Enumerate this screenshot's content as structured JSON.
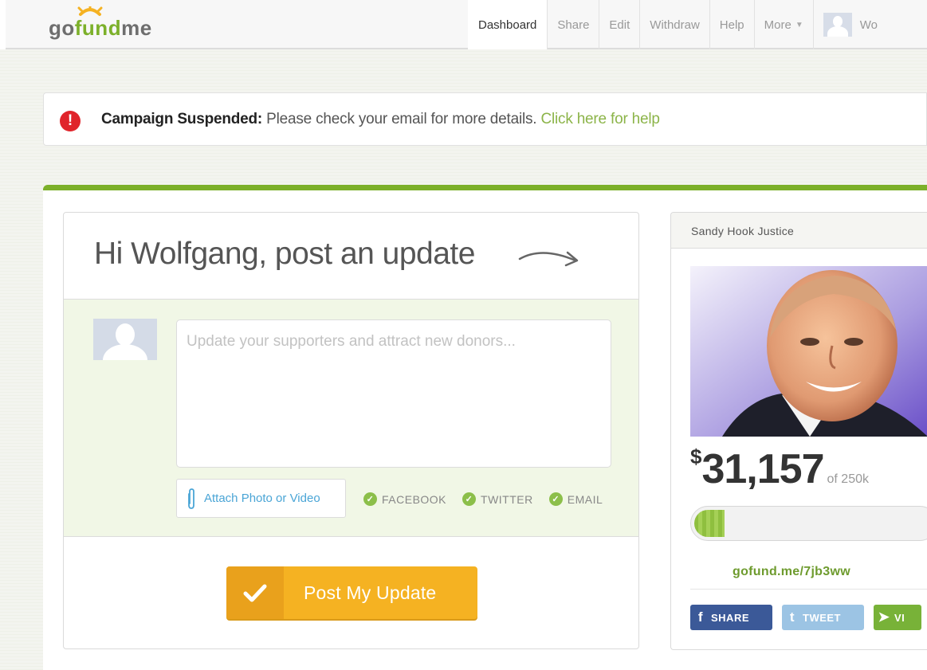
{
  "header": {
    "logo": {
      "go": "go",
      "fund": "fund",
      "me": "me"
    },
    "nav": [
      "Dashboard",
      "Share",
      "Edit",
      "Withdraw",
      "Help",
      "More"
    ],
    "user_name_partial": "Wo"
  },
  "alert": {
    "title": "Campaign Suspended:",
    "message": " Please check your email for more details. ",
    "link": "Click here for help"
  },
  "update": {
    "title": "Hi Wolfgang, post an update",
    "placeholder": "Update your supporters and attract new donors...",
    "attach_label": "Attach Photo or Video",
    "share_options": [
      "FACEBOOK",
      "TWITTER",
      "EMAIL"
    ],
    "post_button": "Post My Update"
  },
  "campaign": {
    "name": "Sandy Hook Justice",
    "currency": "$",
    "raised": "31,157",
    "goal": "of 250k",
    "progress_fraction": 0.125,
    "link": "gofund.me/7jb3ww",
    "share_fb": "SHARE",
    "share_tw": "TWEET",
    "share_view_partial": "VI"
  },
  "colors": {
    "brand_green": "#7cb02a",
    "alert_red": "#e0242b",
    "post_button": "#f5b222",
    "facebook": "#3b5998",
    "twitter": "#9cc4e4"
  }
}
